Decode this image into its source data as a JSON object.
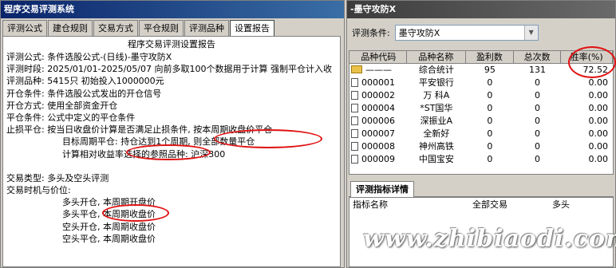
{
  "left": {
    "title": "程序交易评测系统",
    "tabs": [
      "评测公式",
      "建仓规则",
      "交易方式",
      "平仓规则",
      "评测品种",
      "设置报告"
    ],
    "report_title": "程序交易评测设置报告",
    "lines": [
      "评测公式: 条件选股公式-(日线)-墨守攻防X",
      "评测时段: 2025/01/01-2025/05/07 向前多取100个数据用于计算 强制平仓计入收",
      "评测品种: 5415只 初始投入1000000元",
      "开仓条件: 条件选股公式发出的开仓信号",
      "开仓方式: 使用全部资金开仓",
      "平仓条件: 公式中定义的平仓条件",
      "止损平仓: 按当日收盘价计算是否满足止损条件, 按本周期收盘价平仓",
      "目标周期平仓: 持仓达到1个周期, 则全部数量平仓",
      "计算相对收益率选择的参照品种: 沪深300",
      "",
      "交易类型: 多头及空头评测",
      "交易时机与价位:",
      "多头开仓, 本周期开盘价",
      "多头平仓, 本周期收盘价",
      "空头开仓, 本周期收盘价",
      "空头平仓, 本周期收盘价"
    ]
  },
  "right": {
    "title": "-墨守攻防X",
    "condition_label": "评测条件:",
    "condition_value": "墨守攻防X",
    "grid_headers": [
      "品种代码",
      "品种名称",
      "盈利数",
      "总次数",
      "胜率(%)"
    ],
    "summary": {
      "code": "———",
      "name": "综合统计",
      "win": "95",
      "total": "131",
      "rate": "72.52"
    },
    "rows": [
      {
        "code": "000001",
        "name": "平安银行",
        "win": "0",
        "total": "0",
        "rate": "0.00"
      },
      {
        "code": "000002",
        "name": "万 科A",
        "win": "0",
        "total": "0",
        "rate": "0.00"
      },
      {
        "code": "000004",
        "name": "*ST国华",
        "win": "0",
        "total": "0",
        "rate": "0.00"
      },
      {
        "code": "000006",
        "name": "深振业A",
        "win": "0",
        "total": "0",
        "rate": "0.00"
      },
      {
        "code": "000007",
        "name": "全新好",
        "win": "0",
        "total": "0",
        "rate": "0.00"
      },
      {
        "code": "000008",
        "name": "神州高铁",
        "win": "0",
        "total": "0",
        "rate": "0.00"
      },
      {
        "code": "000009",
        "name": "中国宝安",
        "win": "0",
        "total": "0",
        "rate": "0.00"
      }
    ],
    "detail_tab": "评测指标详情",
    "detail_headers": [
      "指标名称",
      "全部交易",
      "多头"
    ]
  },
  "watermark": "www.zhibiaodi.com",
  "colors": {
    "annotation": "#e01010",
    "title_bar": "#0a246a"
  }
}
